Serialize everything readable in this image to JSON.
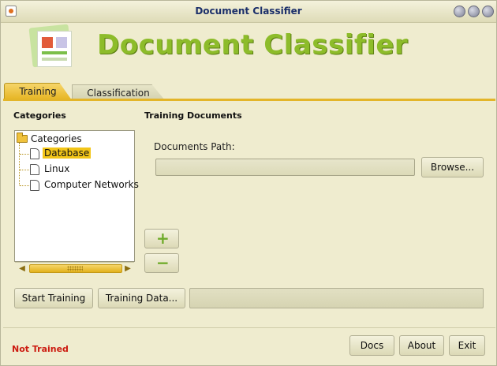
{
  "window": {
    "title": "Document Classifier"
  },
  "header": {
    "app_name": "Document Classifier",
    "logo_icon": "document-layout-icon"
  },
  "tabs": [
    {
      "label": "Training",
      "active": true
    },
    {
      "label": "Classification",
      "active": false
    }
  ],
  "categories_panel": {
    "title": "Categories",
    "tree": {
      "root_label": "Categories",
      "items": [
        {
          "label": "Database",
          "selected": true
        },
        {
          "label": "Linux",
          "selected": false
        },
        {
          "label": "Computer Networks",
          "selected": false
        }
      ]
    }
  },
  "training_documents": {
    "title": "Training Documents",
    "path_label": "Documents Path:",
    "path_value": "",
    "browse_label": "Browse...",
    "add_icon": "plus-icon",
    "remove_icon": "minus-icon"
  },
  "actions": {
    "start_training_label": "Start Training",
    "training_data_label": "Training Data...",
    "progress": 0
  },
  "footer": {
    "status_text": "Not Trained",
    "status_color": "#cc1b10",
    "docs_label": "Docs",
    "about_label": "About",
    "exit_label": "Exit"
  },
  "colors": {
    "accent": "#f2c518",
    "brand_green": "#8dbc2a",
    "window_bg": "#efeccf"
  }
}
